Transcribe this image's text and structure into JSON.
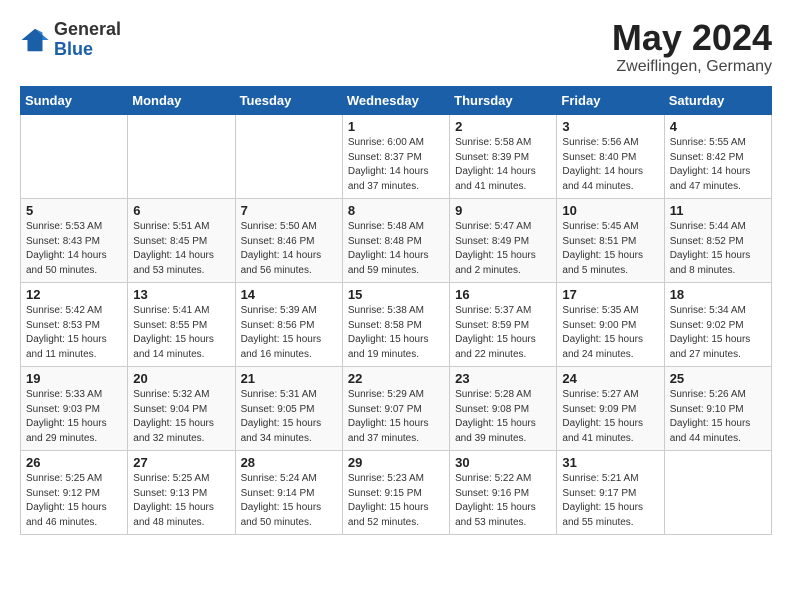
{
  "logo": {
    "general": "General",
    "blue": "Blue"
  },
  "title": {
    "month_year": "May 2024",
    "location": "Zweiflingen, Germany"
  },
  "days_of_week": [
    "Sunday",
    "Monday",
    "Tuesday",
    "Wednesday",
    "Thursday",
    "Friday",
    "Saturday"
  ],
  "weeks": [
    [
      {
        "day": "",
        "info": ""
      },
      {
        "day": "",
        "info": ""
      },
      {
        "day": "",
        "info": ""
      },
      {
        "day": "1",
        "info": "Sunrise: 6:00 AM\nSunset: 8:37 PM\nDaylight: 14 hours\nand 37 minutes."
      },
      {
        "day": "2",
        "info": "Sunrise: 5:58 AM\nSunset: 8:39 PM\nDaylight: 14 hours\nand 41 minutes."
      },
      {
        "day": "3",
        "info": "Sunrise: 5:56 AM\nSunset: 8:40 PM\nDaylight: 14 hours\nand 44 minutes."
      },
      {
        "day": "4",
        "info": "Sunrise: 5:55 AM\nSunset: 8:42 PM\nDaylight: 14 hours\nand 47 minutes."
      }
    ],
    [
      {
        "day": "5",
        "info": "Sunrise: 5:53 AM\nSunset: 8:43 PM\nDaylight: 14 hours\nand 50 minutes."
      },
      {
        "day": "6",
        "info": "Sunrise: 5:51 AM\nSunset: 8:45 PM\nDaylight: 14 hours\nand 53 minutes."
      },
      {
        "day": "7",
        "info": "Sunrise: 5:50 AM\nSunset: 8:46 PM\nDaylight: 14 hours\nand 56 minutes."
      },
      {
        "day": "8",
        "info": "Sunrise: 5:48 AM\nSunset: 8:48 PM\nDaylight: 14 hours\nand 59 minutes."
      },
      {
        "day": "9",
        "info": "Sunrise: 5:47 AM\nSunset: 8:49 PM\nDaylight: 15 hours\nand 2 minutes."
      },
      {
        "day": "10",
        "info": "Sunrise: 5:45 AM\nSunset: 8:51 PM\nDaylight: 15 hours\nand 5 minutes."
      },
      {
        "day": "11",
        "info": "Sunrise: 5:44 AM\nSunset: 8:52 PM\nDaylight: 15 hours\nand 8 minutes."
      }
    ],
    [
      {
        "day": "12",
        "info": "Sunrise: 5:42 AM\nSunset: 8:53 PM\nDaylight: 15 hours\nand 11 minutes."
      },
      {
        "day": "13",
        "info": "Sunrise: 5:41 AM\nSunset: 8:55 PM\nDaylight: 15 hours\nand 14 minutes."
      },
      {
        "day": "14",
        "info": "Sunrise: 5:39 AM\nSunset: 8:56 PM\nDaylight: 15 hours\nand 16 minutes."
      },
      {
        "day": "15",
        "info": "Sunrise: 5:38 AM\nSunset: 8:58 PM\nDaylight: 15 hours\nand 19 minutes."
      },
      {
        "day": "16",
        "info": "Sunrise: 5:37 AM\nSunset: 8:59 PM\nDaylight: 15 hours\nand 22 minutes."
      },
      {
        "day": "17",
        "info": "Sunrise: 5:35 AM\nSunset: 9:00 PM\nDaylight: 15 hours\nand 24 minutes."
      },
      {
        "day": "18",
        "info": "Sunrise: 5:34 AM\nSunset: 9:02 PM\nDaylight: 15 hours\nand 27 minutes."
      }
    ],
    [
      {
        "day": "19",
        "info": "Sunrise: 5:33 AM\nSunset: 9:03 PM\nDaylight: 15 hours\nand 29 minutes."
      },
      {
        "day": "20",
        "info": "Sunrise: 5:32 AM\nSunset: 9:04 PM\nDaylight: 15 hours\nand 32 minutes."
      },
      {
        "day": "21",
        "info": "Sunrise: 5:31 AM\nSunset: 9:05 PM\nDaylight: 15 hours\nand 34 minutes."
      },
      {
        "day": "22",
        "info": "Sunrise: 5:29 AM\nSunset: 9:07 PM\nDaylight: 15 hours\nand 37 minutes."
      },
      {
        "day": "23",
        "info": "Sunrise: 5:28 AM\nSunset: 9:08 PM\nDaylight: 15 hours\nand 39 minutes."
      },
      {
        "day": "24",
        "info": "Sunrise: 5:27 AM\nSunset: 9:09 PM\nDaylight: 15 hours\nand 41 minutes."
      },
      {
        "day": "25",
        "info": "Sunrise: 5:26 AM\nSunset: 9:10 PM\nDaylight: 15 hours\nand 44 minutes."
      }
    ],
    [
      {
        "day": "26",
        "info": "Sunrise: 5:25 AM\nSunset: 9:12 PM\nDaylight: 15 hours\nand 46 minutes."
      },
      {
        "day": "27",
        "info": "Sunrise: 5:25 AM\nSunset: 9:13 PM\nDaylight: 15 hours\nand 48 minutes."
      },
      {
        "day": "28",
        "info": "Sunrise: 5:24 AM\nSunset: 9:14 PM\nDaylight: 15 hours\nand 50 minutes."
      },
      {
        "day": "29",
        "info": "Sunrise: 5:23 AM\nSunset: 9:15 PM\nDaylight: 15 hours\nand 52 minutes."
      },
      {
        "day": "30",
        "info": "Sunrise: 5:22 AM\nSunset: 9:16 PM\nDaylight: 15 hours\nand 53 minutes."
      },
      {
        "day": "31",
        "info": "Sunrise: 5:21 AM\nSunset: 9:17 PM\nDaylight: 15 hours\nand 55 minutes."
      },
      {
        "day": "",
        "info": ""
      }
    ]
  ]
}
